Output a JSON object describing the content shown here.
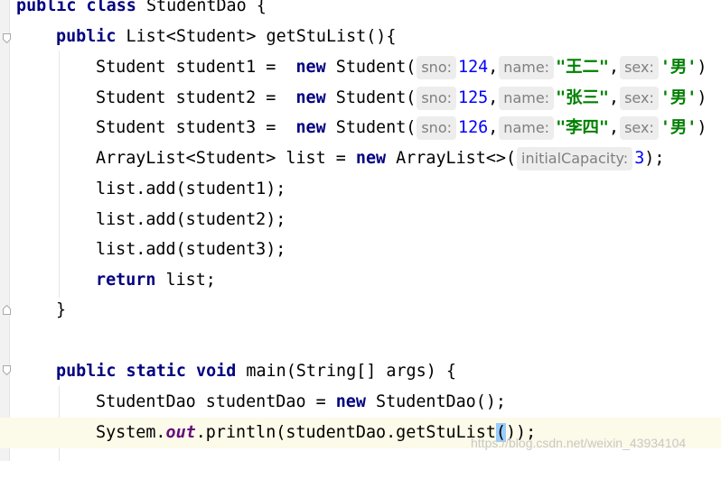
{
  "editor": {
    "lines": {
      "l1": {
        "kw1": "public",
        "kw2": "class",
        "rest": " StudentDao {"
      },
      "l2": {
        "kw1": "public",
        "rest": " List<Student> getStuList(){"
      },
      "l3": {
        "type": "Student",
        "var": " student1 = ",
        "kw": "new",
        "ctor": " Student(",
        "hint_sno": "sno:",
        "sno": "124",
        "hint_name": "name:",
        "name": "\"王二\"",
        "hint_sex": "sex:",
        "sex": "'男'",
        "end": ")"
      },
      "l4": {
        "type": "Student",
        "var": " student2 = ",
        "kw": "new",
        "ctor": " Student(",
        "hint_sno": "sno:",
        "sno": "125",
        "hint_name": "name:",
        "name": "\"张三\"",
        "hint_sex": "sex:",
        "sex": "'男'",
        "end": ")"
      },
      "l5": {
        "type": "Student",
        "var": " student3 = ",
        "kw": "new",
        "ctor": " Student(",
        "hint_sno": "sno:",
        "sno": "126",
        "hint_name": "name:",
        "name": "\"李四\"",
        "hint_sex": "sex:",
        "sex": "'男'",
        "end": ")"
      },
      "l6": {
        "pre": "ArrayList<Student> list = ",
        "kw": "new",
        "mid": " ArrayList<>(",
        "hint": "initialCapacity:",
        "num": "3",
        "end": ");"
      },
      "l7": {
        "text": "list.add(student1);"
      },
      "l8": {
        "text": "list.add(student2);"
      },
      "l9": {
        "text": "list.add(student3);"
      },
      "l10": {
        "kw": "return",
        "rest": " list;"
      },
      "l11": {
        "text": "}"
      },
      "l12": {
        "kw1": "public",
        "kw2": "static",
        "kw3": "void",
        "rest": " main(String[] args) {"
      },
      "l13": {
        "pre": "StudentDao studentDao = ",
        "kw": "new",
        "rest": " StudentDao();"
      },
      "l14": {
        "pre": "System.",
        "field": "out",
        "mid": ".println(studentDao.getStuList",
        "hl": "(",
        "end": "));"
      }
    }
  },
  "watermark": "https://blog.csdn.net/weixin_43934104",
  "colors": {
    "keyword": "#000080",
    "number": "#0000ff",
    "string": "#008000",
    "caret_line": "#fcfae8",
    "hint_bg": "#ededed"
  }
}
